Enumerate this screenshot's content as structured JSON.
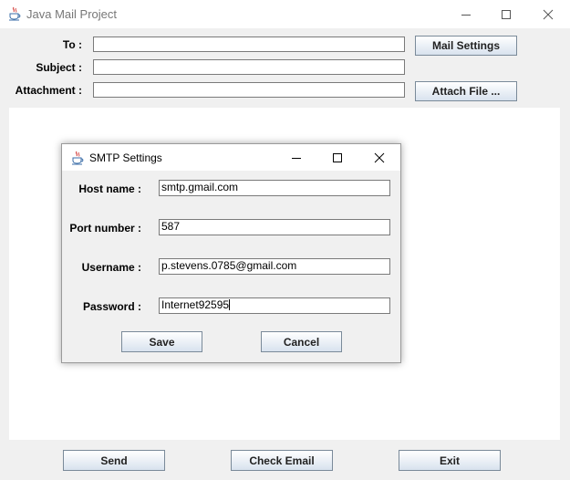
{
  "window": {
    "title": "Java Mail Project"
  },
  "form": {
    "to_label": "To :",
    "subject_label": "Subject :",
    "attachment_label": "Attachment :",
    "to_value": "",
    "subject_value": "",
    "attachment_value": "",
    "mail_settings_label": "Mail Settings",
    "attach_file_label": "Attach File ..."
  },
  "footer": {
    "send_label": "Send",
    "check_email_label": "Check Email",
    "exit_label": "Exit"
  },
  "dialog": {
    "title": "SMTP Settings",
    "host_label": "Host name :",
    "host_value": "smtp.gmail.com",
    "port_label": "Port number :",
    "port_value": "587",
    "username_label": "Username :",
    "username_value": "p.stevens.0785@gmail.com",
    "password_label": "Password :",
    "password_value": "Internet92595",
    "save_label": "Save",
    "cancel_label": "Cancel"
  },
  "icons": {
    "app": "java-cup-icon",
    "minimize": "minimize-icon",
    "maximize": "maximize-icon",
    "close": "close-icon"
  }
}
